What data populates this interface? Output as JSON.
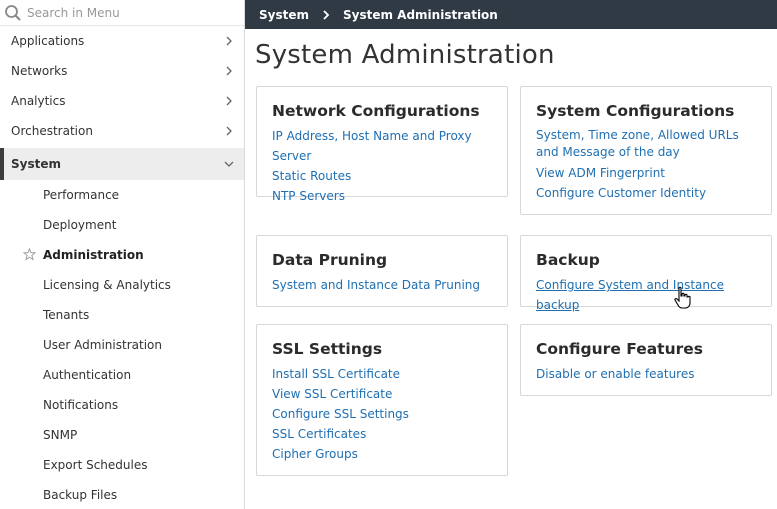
{
  "search": {
    "placeholder": "Search in Menu"
  },
  "sidebar": {
    "items": [
      {
        "label": "Applications"
      },
      {
        "label": "Networks"
      },
      {
        "label": "Analytics"
      },
      {
        "label": "Orchestration"
      },
      {
        "label": "System"
      }
    ],
    "system_sub": [
      {
        "label": "Performance"
      },
      {
        "label": "Deployment"
      },
      {
        "label": "Administration"
      },
      {
        "label": "Licensing & Analytics"
      },
      {
        "label": "Tenants"
      },
      {
        "label": "User Administration"
      },
      {
        "label": "Authentication"
      },
      {
        "label": "Notifications"
      },
      {
        "label": "SNMP"
      },
      {
        "label": "Export Schedules"
      },
      {
        "label": "Backup Files"
      }
    ]
  },
  "breadcrumb": {
    "root": "System",
    "current": "System Administration"
  },
  "page": {
    "title": "System Administration"
  },
  "cards": {
    "network": {
      "title": "Network Configurations",
      "links": [
        "IP Address, Host Name and Proxy Server",
        "Static Routes",
        "NTP Servers"
      ]
    },
    "system": {
      "title": "System Configurations",
      "links": [
        "System, Time zone, Allowed URLs and Message of the day",
        "View ADM Fingerprint",
        "Configure Customer Identity"
      ]
    },
    "pruning": {
      "title": "Data Pruning",
      "links": [
        "System and Instance Data Pruning"
      ]
    },
    "backup": {
      "title": "Backup",
      "links": [
        "Configure System and Instance backup"
      ]
    },
    "ssl": {
      "title": "SSL Settings",
      "links": [
        "Install SSL Certificate",
        "View SSL Certificate",
        "Configure SSL Settings",
        "SSL Certificates",
        "Cipher Groups"
      ]
    },
    "features": {
      "title": "Configure Features",
      "links": [
        "Disable or enable features"
      ]
    }
  },
  "colors": {
    "topbar": "#2f3a45",
    "link": "#1f6fb2",
    "active_bg": "#ededed"
  }
}
